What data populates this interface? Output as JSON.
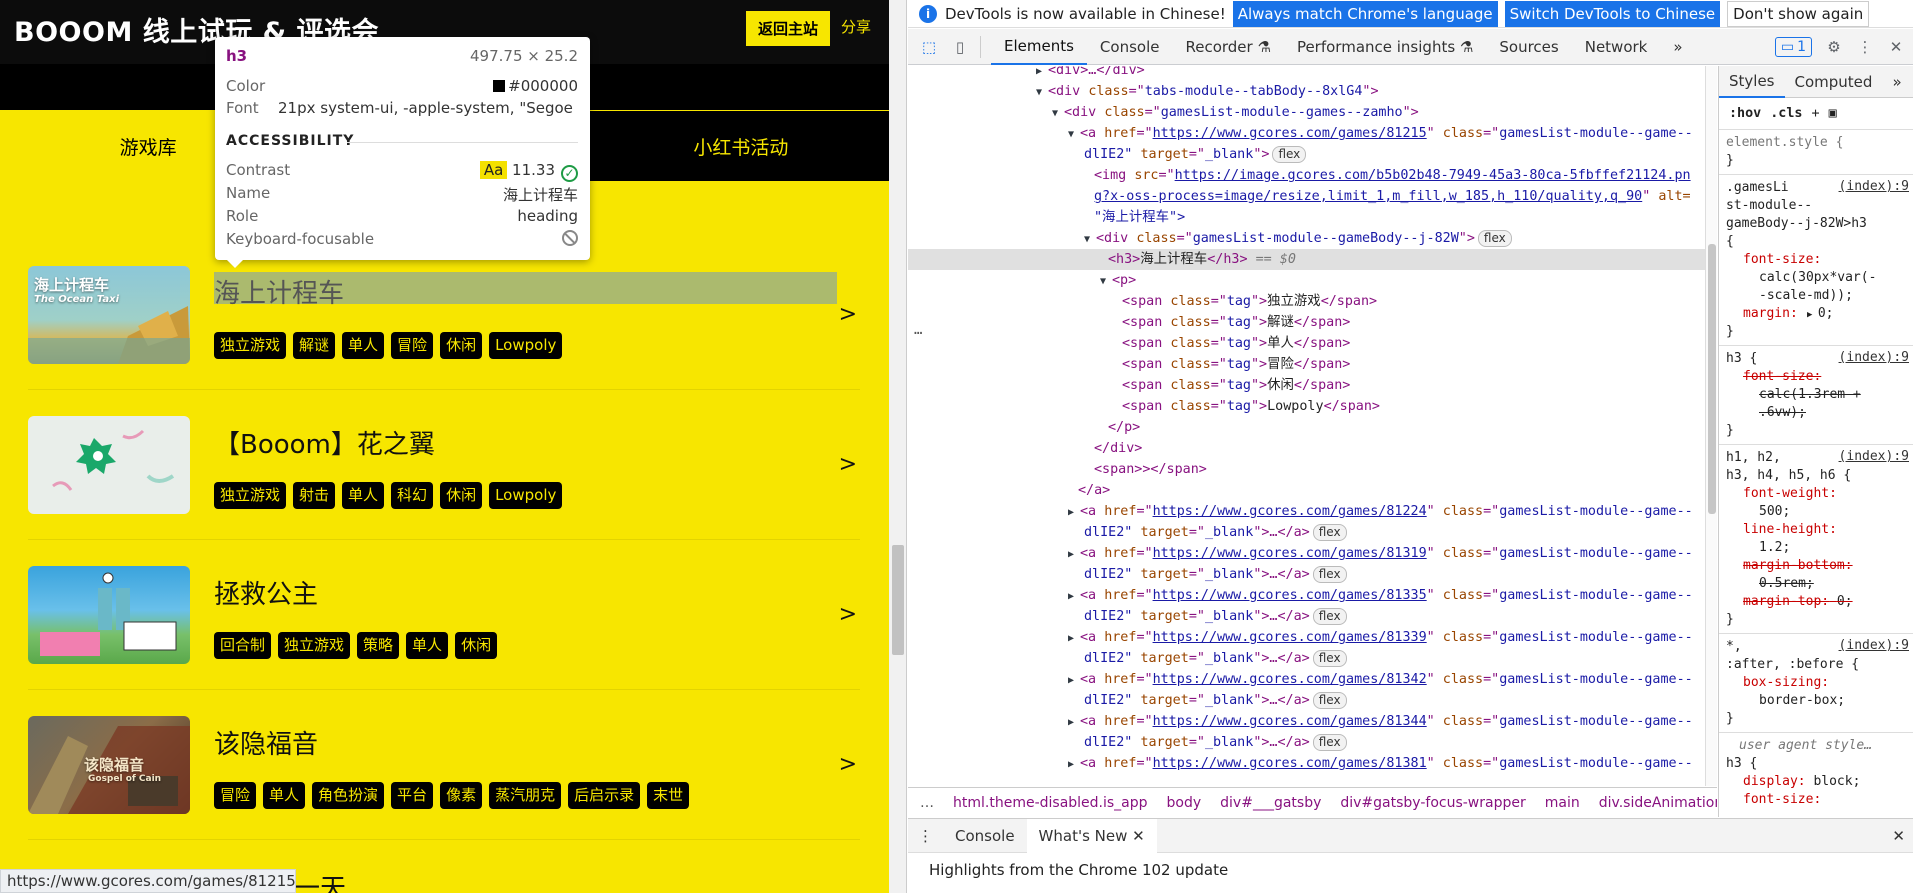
{
  "site": {
    "logo": "BOOOM 线上试玩 & 评选会",
    "home_button": "返回主站",
    "share_button": "分享",
    "tabs": [
      {
        "label": "游戏库",
        "active": true
      },
      {
        "label": "",
        "active": false
      },
      {
        "label": "小红书活动",
        "active": false
      }
    ],
    "games": [
      {
        "title": "海上计程车",
        "cover_text": "海上计程车",
        "cover_sub": "The Ocean Taxi",
        "tags": [
          "独立游戏",
          "解谜",
          "单人",
          "冒险",
          "休闲",
          "Lowpoly"
        ],
        "cover_color": "#7fb7c8",
        "highlighted": true
      },
      {
        "title": "【Booom】花之翼",
        "cover_text": "",
        "cover_sub": "",
        "tags": [
          "独立游戏",
          "射击",
          "单人",
          "科幻",
          "休闲",
          "Lowpoly"
        ],
        "cover_color": "#e6ebe7",
        "highlighted": false
      },
      {
        "title": "拯救公主",
        "cover_text": "",
        "cover_sub": "",
        "tags": [
          "回合制",
          "独立游戏",
          "策略",
          "单人",
          "休闲"
        ],
        "cover_color": "#4aa8d8",
        "highlighted": false
      },
      {
        "title": "该隐福音",
        "cover_text": "该隐福音",
        "cover_sub": "Gospel of Cain",
        "tags": [
          "冒险",
          "单人",
          "角色扮演",
          "平台",
          "像素",
          "蒸汽朋克",
          "后启示录",
          "末世"
        ],
        "cover_color": "#8a6a45",
        "highlighted": false
      }
    ],
    "arrow": ">",
    "status_url": "https://www.gcores.com/games/81215",
    "partial_title": "一天"
  },
  "tooltip": {
    "tag": "h3",
    "size": "497.75 × 25.2",
    "color_label": "Color",
    "color_value": "#000000",
    "font_label": "Font",
    "font_value": "21px system-ui, -apple-system, \"Segoe U...",
    "accessibility_heading": "ACCESSIBILITY",
    "contrast_label": "Contrast",
    "contrast_aa": "Aa",
    "contrast_value": "11.33",
    "name_label": "Name",
    "name_value": "海上计程车",
    "role_label": "Role",
    "role_value": "heading",
    "focus_label": "Keyboard-focusable"
  },
  "devtools": {
    "infobar": {
      "message": "DevTools is now available in Chinese!",
      "btn_match": "Always match Chrome's language",
      "btn_switch": "Switch DevTools to Chinese",
      "btn_dismiss": "Don't show again"
    },
    "tabs": [
      "Elements",
      "Console",
      "Recorder",
      "Performance insights",
      "Sources",
      "Network"
    ],
    "active_tab": "Elements",
    "messages_count": "1",
    "elements": {
      "l0_tag": "<div>…</div>",
      "l1_class": "tabs-module--tabBody--8xlG4",
      "l2_class": "gamesList-module--games--zamho",
      "l3_href": "https://www.gcores.com/games/81215",
      "l3_class": "gamesList-module--game--",
      "l4_cont": "dlIE2\"",
      "l4_target": "_blank",
      "l5_src": "https://image.gcores.com/b5b02b48-7949-45a3-80ca-5fbffef21124.pn",
      "l6_cont": "g?x-oss-process=image/resize,limit_1,m_fill,w_185,h_110/quality,q_90",
      "l6_alt": "alt=",
      "l7_text": "\"海上计程车\">",
      "l8_class": "gamesList-module--gameBody--j-82W",
      "l9_text": "海上计程车",
      "l9_eq": "== $0",
      "tag_class": "tag",
      "tags": [
        "独立游戏",
        "解谜",
        "单人",
        "冒险",
        "休闲",
        "Lowpoly"
      ],
      "span_close": "<span>></span>",
      "rows": [
        {
          "href": "https://www.gcores.com/games/81224"
        },
        {
          "href": "https://www.gcores.com/games/81319"
        },
        {
          "href": "https://www.gcores.com/games/81335"
        },
        {
          "href": "https://www.gcores.com/games/81339"
        },
        {
          "href": "https://www.gcores.com/games/81342"
        },
        {
          "href": "https://www.gcores.com/games/81344"
        },
        {
          "href": "https://www.gcores.com/games/81381"
        }
      ],
      "flex_badge": "flex"
    },
    "breadcrumbs": [
      "html.theme-disabled.is_app",
      "body",
      "div#___gatsby",
      "div#gatsby-focus-wrapper",
      "main",
      "div.sideAnimationCc"
    ],
    "styles": {
      "tab_styles": "Styles",
      "tab_computed": "Computed",
      "filter_hov": ":hov",
      "filter_cls": ".cls",
      "element_style": "element.style {",
      "index_src": "(index):9",
      "rule1_sel_a": ".gamesLi",
      "rule1_sel_b": "st-module--",
      "rule1_sel_c": "gameBody--j-82W>h3",
      "font_size_prop": "font-size:",
      "rule1_fs_val_a": "calc(30px*var(-",
      "rule1_fs_val_b": "-scale-md));",
      "margin_prop": "margin:",
      "margin_val": "0;",
      "rule2_sel": "h3 {",
      "rule2_fs_val_a": "calc(1.3rem +",
      "rule2_fs_val_b": ".6vw);",
      "rule3_sel_a": "h1, h2,",
      "rule3_sel_b": "h3, h4, h5, h6 {",
      "fw_prop": "font-weight:",
      "fw_val": "500;",
      "lh_prop": "line-height:",
      "lh_val": "1.2;",
      "mb_prop": "margin-bottom:",
      "mb_val": "0.5rem;",
      "mt_prop": "margin-top:",
      "mt_val": "0;",
      "rule4_sel_a": "*,",
      "rule4_sel_b": ":after, :before {",
      "bs_prop": "box-sizing:",
      "bs_val": "border-box;",
      "ua_label": "user agent style…",
      "ua_sel": "h3 {",
      "display_prop": "display:",
      "display_val": "block;",
      "ua_last": "font-size:"
    },
    "drawer": {
      "tabs": [
        "Console",
        "What's New"
      ],
      "body": "Highlights from the Chrome 102 update"
    }
  },
  "colors": {
    "site_yellow": "#f7e600",
    "devtools_blue": "#1a73e8",
    "tag_purple": "#881280"
  }
}
